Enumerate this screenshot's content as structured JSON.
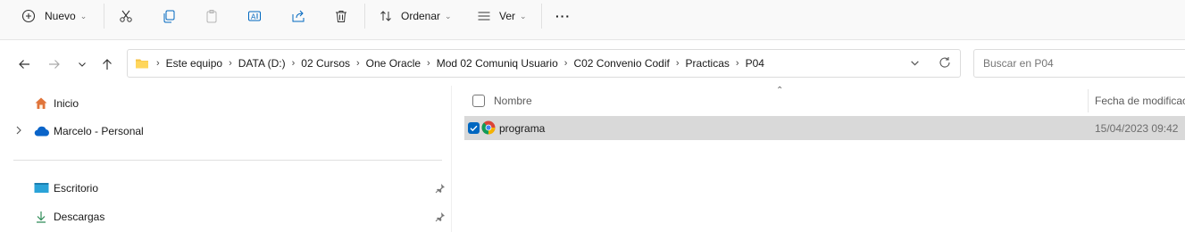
{
  "toolbar": {
    "new_label": "Nuevo",
    "sort_label": "Ordenar",
    "view_label": "Ver",
    "more_label": "···",
    "icons": [
      "plus-circle-icon",
      "cut-icon",
      "copy-icon",
      "paste-icon",
      "rename-icon",
      "share-icon",
      "delete-icon",
      "sort-icon",
      "view-icon",
      "more-icon"
    ]
  },
  "address": {
    "crumbs": [
      "Este equipo",
      "DATA (D:)",
      "02 Cursos",
      "One Oracle",
      "Mod 02 Comuniq Usuario",
      "C02 Convenio Codif",
      "Practicas",
      "P04"
    ]
  },
  "search": {
    "placeholder": "Buscar en P04"
  },
  "sidebar": {
    "items": [
      {
        "label": "Inicio",
        "icon": "home-icon"
      },
      {
        "label": "Marcelo - Personal",
        "icon": "cloud-icon"
      },
      {
        "label": "Escritorio",
        "icon": "desktop-icon",
        "pinned": true
      },
      {
        "label": "Descargas",
        "icon": "download-icon",
        "pinned": true
      }
    ]
  },
  "file_list": {
    "columns": [
      "Nombre",
      "Fecha de modificac"
    ],
    "rows": [
      {
        "name": "programa",
        "modified": "15/04/2023 09:42",
        "selected": true,
        "icon": "chrome-icon"
      }
    ]
  },
  "colors": {
    "accent": "#0067c0",
    "folder": "#f5c244",
    "selected_row": "#d9d9d9"
  }
}
